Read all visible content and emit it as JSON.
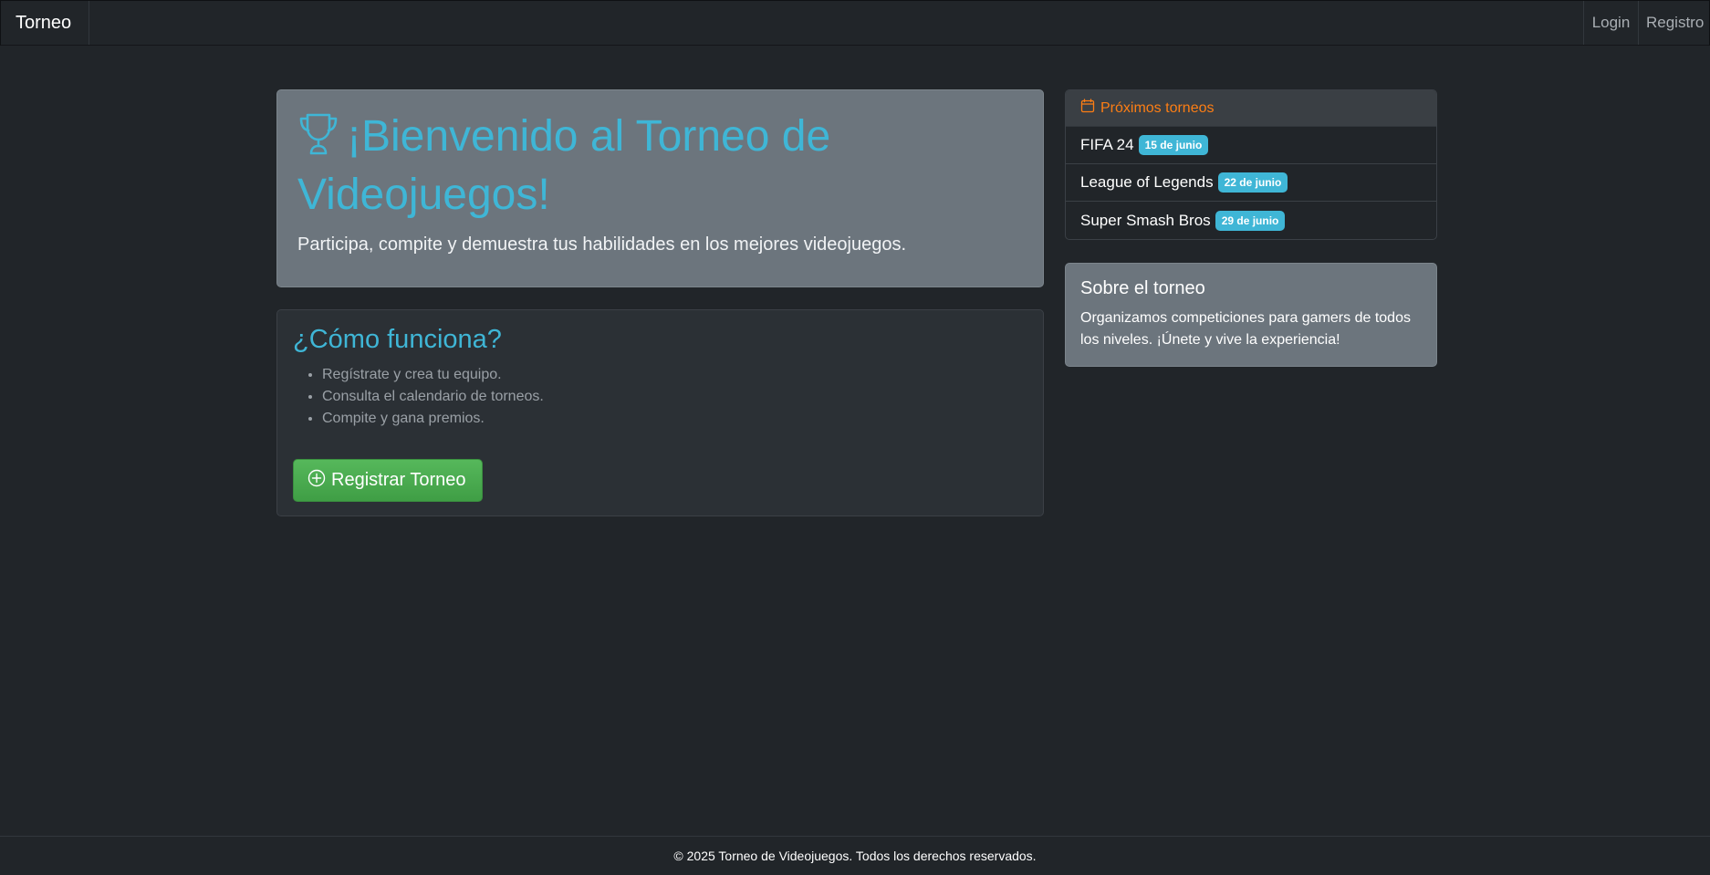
{
  "navbar": {
    "brand": "Torneo",
    "links": {
      "login": "Login",
      "registro": "Registro"
    }
  },
  "hero": {
    "title": "¡Bienvenido al Torneo de Videojuegos!",
    "subtitle": "Participa, compite y demuestra tus habilidades en los mejores videojuegos."
  },
  "how": {
    "title": "¿Cómo funciona?",
    "steps": [
      "Regístrate y crea tu equipo.",
      "Consulta el calendario de torneos.",
      "Compite y gana premios."
    ],
    "button_label": "Registrar Torneo"
  },
  "upcoming": {
    "header": "Próximos torneos",
    "items": [
      {
        "name": "FIFA 24",
        "date": "15 de junio"
      },
      {
        "name": "League of Legends",
        "date": "22 de junio"
      },
      {
        "name": "Super Smash Bros",
        "date": "29 de junio"
      }
    ]
  },
  "about": {
    "title": "Sobre el torneo",
    "text": "Organizamos competiciones para gamers de todos los niveles. ¡Únete y vive la experiencia!"
  },
  "footer": {
    "text": "© 2025 Torneo de Videojuegos. Todos los derechos reservados."
  },
  "colors": {
    "background": "#212529",
    "accent": "#3fb6d6",
    "success": "#4caf50",
    "warning": "#fd7e14",
    "secondary": "#6c757d"
  },
  "icons": {
    "hero": "trophy-icon",
    "button": "plus-circle-icon",
    "upcoming": "calendar-icon"
  }
}
